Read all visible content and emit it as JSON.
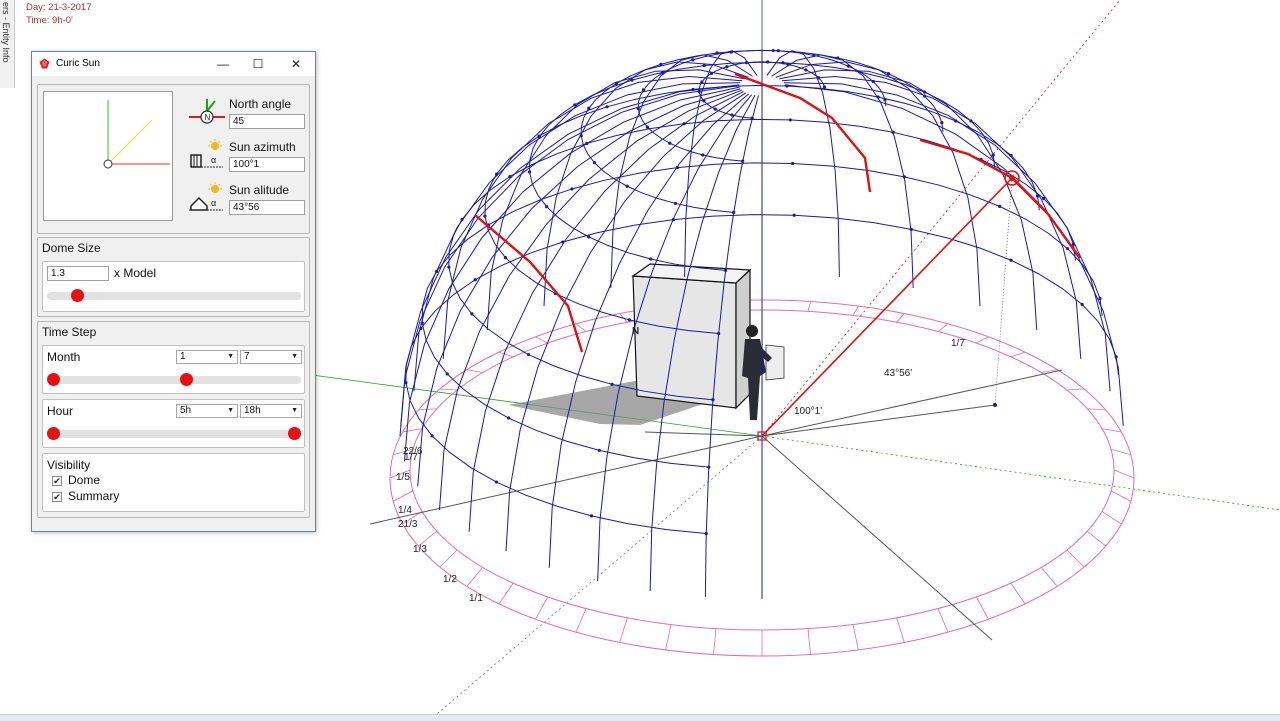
{
  "status": {
    "day": "Day: 21-3-2017",
    "time": "Time: 9h-0'"
  },
  "side_tab": {
    "label": "ers - Entity Info"
  },
  "dialog": {
    "title": "Curic Sun",
    "icon": "ruby-icon",
    "window_controls": {
      "minimize": "—",
      "maximize": "☐",
      "close": "✕"
    },
    "north_angle": {
      "label": "North angle",
      "value": "45",
      "icon": "north-compass-icon"
    },
    "sun_azimuth": {
      "label": "Sun azimuth",
      "value": "100°1",
      "icon": "sun-azimuth-icon"
    },
    "sun_altitude": {
      "label": "Sun alitude",
      "value": "43°56",
      "icon": "sun-altitude-icon"
    },
    "dome_size": {
      "label": "Dome Size",
      "value": "1.3",
      "unit_label": "x Model",
      "slider_fraction": 0.1
    },
    "time_step": {
      "label": "Time Step",
      "month": {
        "label": "Month",
        "from": "1",
        "to": "7",
        "slider_from_fraction": 0.0,
        "slider_to_fraction": 0.55
      },
      "hour": {
        "label": "Hour",
        "from": "5h",
        "to": "18h",
        "slider_from_fraction": 0.0,
        "slider_to_fraction": 1.0
      }
    },
    "visibility": {
      "label": "Visibility",
      "dome": {
        "label": "Dome",
        "checked": true
      },
      "summary": {
        "label": "Summary",
        "checked": true
      }
    }
  },
  "viewport": {
    "north_marker": "N",
    "altitude_label": "43°56'",
    "azimuth_label": "100°1'",
    "date_labels": [
      "22/6",
      "1/7",
      "1/6",
      "1/5",
      "1/4",
      "21/3",
      "1/3",
      "1/2",
      "1/1",
      "1/7"
    ],
    "colors": {
      "dome": "#1a1aa8",
      "sun_path": "#dd1111",
      "ground_ring": "#e070a8",
      "axis_green": "#2aa02a",
      "axis_red": "#cc2222",
      "axis_blue": "#3030cc"
    }
  }
}
